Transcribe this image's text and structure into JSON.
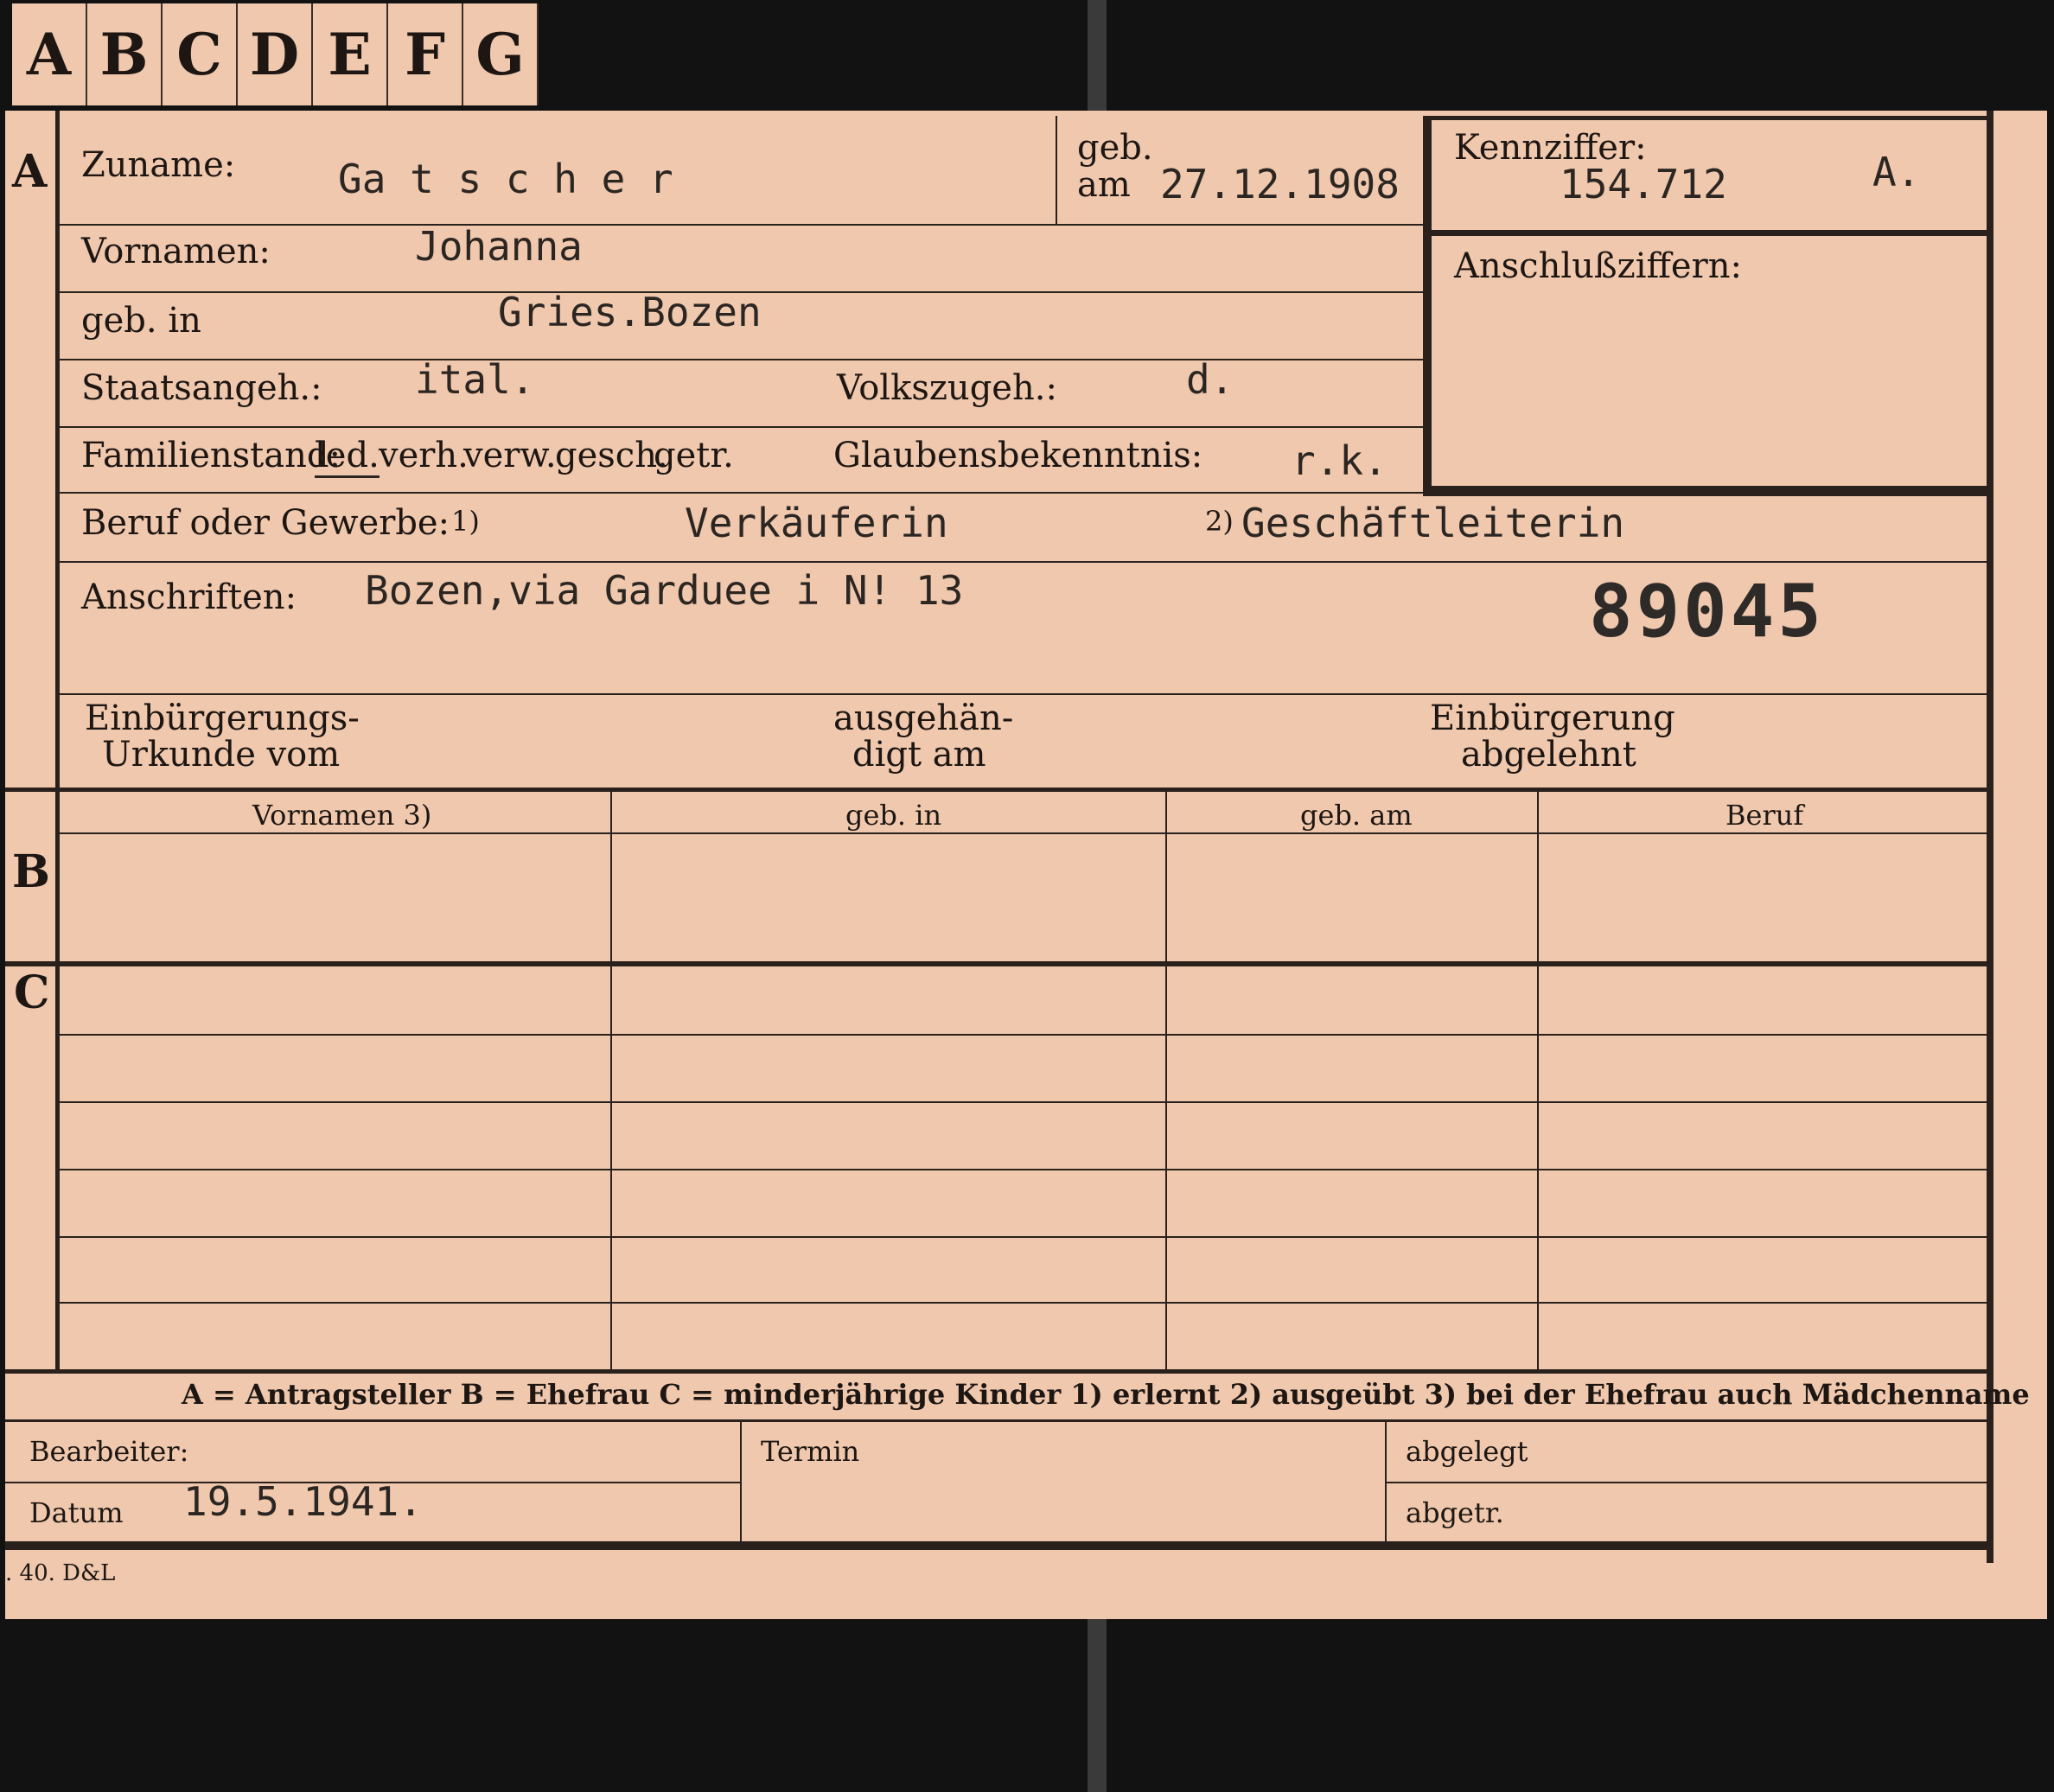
{
  "tabs": [
    "A",
    "B",
    "C",
    "D",
    "E",
    "F",
    "G"
  ],
  "sections": {
    "a": "A",
    "b": "B",
    "c": "C"
  },
  "labels": {
    "zuname": "Zuname:",
    "geb": "geb.",
    "am": "am",
    "kennziffer": "Kennziffer:",
    "anschlussziffern": "Anschlußziffern:",
    "vornamen": "Vornamen:",
    "geb_in": "geb. in",
    "staatsangeh": "Staatsangeh.:",
    "volkszugeh": "Volkszugeh.:",
    "familienstand": "Familienstand:",
    "familienstand_options": [
      "led.",
      "verh.",
      "verw.",
      "gesch.",
      "getr."
    ],
    "glaubensbekenntnis": "Glaubensbekenntnis:",
    "beruf": "Beruf oder Gewerbe:",
    "note1": "1)",
    "note2": "2)",
    "anschriften": "Anschriften:",
    "einbuergerung_urkunde": [
      "Einbürgerungs-",
      "Urkunde vom"
    ],
    "ausgehaendigt": [
      "ausgehän-",
      "digt am"
    ],
    "einbuergerung_abgelehnt": [
      "Einbürgerung",
      "abgelehnt"
    ]
  },
  "values": {
    "zuname": "Ga t s c h e r",
    "geb_am": "27.12.1908",
    "kennziffer": "154.712",
    "kennziffer_suffix": "A.",
    "vornamen": "Johanna",
    "geb_in": "Gries.Bozen",
    "staatsangeh": "ital.",
    "volkszugeh": "d.",
    "glaubensbekenntnis": "r.k.",
    "beruf_erlernt": "Verkäuferin",
    "beruf_ausgeuebt": "Geschäftleiterin",
    "anschrift": "Bozen,via Garduee i N! 13",
    "stamp_number": "89045"
  },
  "table_headers": [
    "Vornamen 3)",
    "geb. in",
    "geb. am",
    "Beruf"
  ],
  "legend": "A = Antragsteller   B = Ehefrau   C = minderjährige Kinder   1) erlernt   2) ausgeübt   3) bei der Ehefrau auch Mädchenname",
  "footer": {
    "bearbeiter": "Bearbeiter:",
    "datum": "Datum",
    "datum_value": "19.5.1941.",
    "termin": "Termin",
    "abgelegt": "abgelegt",
    "abgetr": "abgetr.",
    "print_mark": ". 40. D&L"
  }
}
